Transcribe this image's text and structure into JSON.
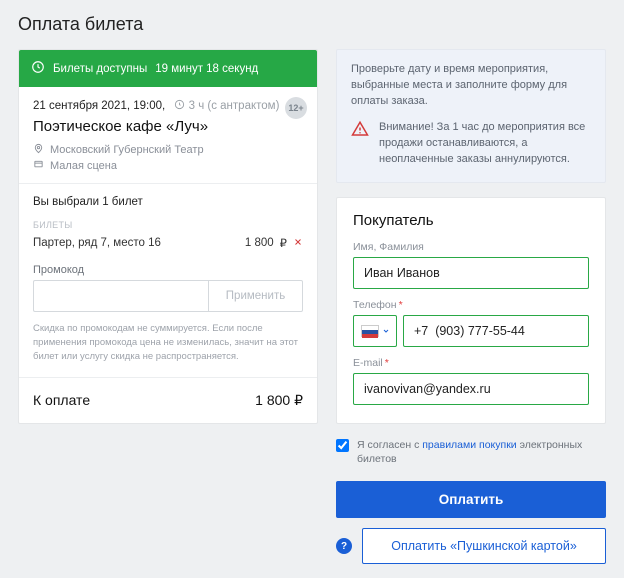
{
  "page_title": "Оплата билета",
  "countdown": {
    "prefix": "Билеты доступны",
    "value": "19 минут 18 секунд"
  },
  "event": {
    "datetime": "21 сентября 2021, 19:00,",
    "duration": "3 ч (с антрактом)",
    "title": "Поэтическое кафе «Луч»",
    "venue": "Московский Губернский Театр",
    "hall": "Малая сцена",
    "age": "12+"
  },
  "selection": {
    "summary": "Вы выбрали 1 билет",
    "section_label": "БИЛЕТЫ",
    "ticket": {
      "seat": "Партер, ряд 7, место 16",
      "price": "1 800",
      "currency": "₽"
    }
  },
  "promo": {
    "label": "Промокод",
    "apply": "Применить",
    "note": "Скидка по промокодам не суммируется. Если после применения промокода цена не изменилась, значит на этот билет или услугу скидка не распространяется."
  },
  "total": {
    "label": "К оплате",
    "value": "1 800",
    "currency": "₽"
  },
  "info": {
    "check": "Проверьте дату и время мероприятия, выбранные места и заполните форму для оплаты заказа.",
    "warn": "Внимание! За 1 час до мероприятия все продажи останавливаются, а неоплаченные заказы аннулируются."
  },
  "buyer": {
    "heading": "Покупатель",
    "name_label": "Имя, Фамилия",
    "name_value": "Иван Иванов",
    "phone_label": "Телефон",
    "phone_value": "+7  (903) 777-55-44",
    "email_label": "E-mail",
    "email_value": "ivanovivan@yandex.ru"
  },
  "agree": {
    "pre": "Я согласен с ",
    "link": "правилами покупки",
    "post": " электронных билетов"
  },
  "buttons": {
    "pay": "Оплатить",
    "pushkin": "Оплатить «Пушкинской картой»"
  }
}
